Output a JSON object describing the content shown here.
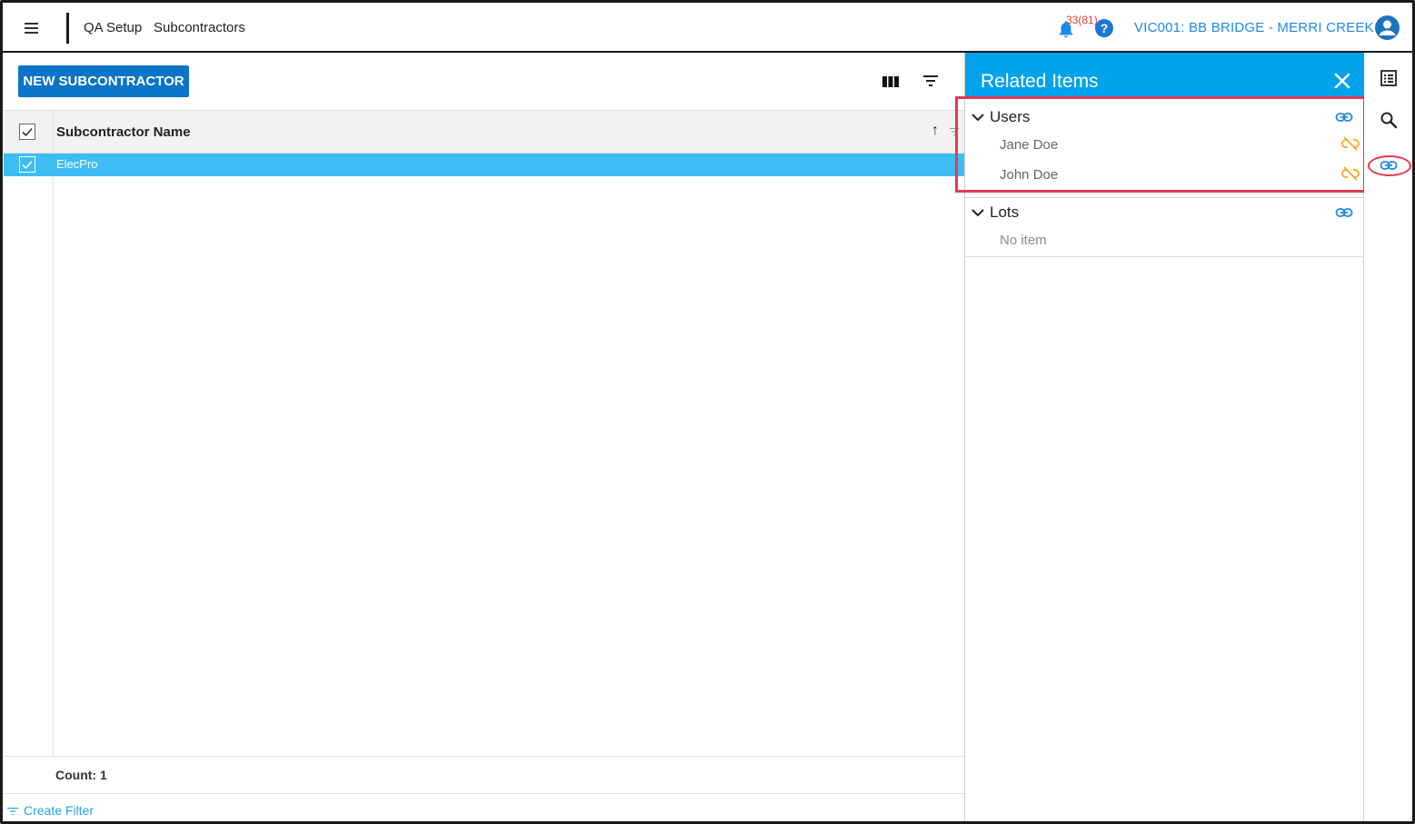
{
  "header": {
    "breadcrumb": [
      "QA Setup",
      "Subcontractors"
    ],
    "notification_count": "33(81)",
    "help_label": "?",
    "project": "VIC001: BB BRIDGE - MERRI CREEK"
  },
  "toolbar": {
    "new_button_label": "NEW SUBCONTRACTOR"
  },
  "grid": {
    "column_header": "Subcontractor Name",
    "sort_indicator": "↑",
    "rows": [
      {
        "name": "ElecPro",
        "selected": true
      }
    ],
    "count_label": "Count: 1",
    "create_filter_label": "Create Filter"
  },
  "related": {
    "title": "Related Items",
    "sections": [
      {
        "title": "Users",
        "items": [
          "Jane Doe",
          "John Doe"
        ]
      },
      {
        "title": "Lots",
        "empty_text": "No item"
      }
    ]
  },
  "colors": {
    "primary": "#0a74c9",
    "header_blue": "#03a2ec",
    "selected_row": "#3dbcf5",
    "link_blue": "#1e88e5",
    "unlink_orange": "#f5a623",
    "annotation_red": "#e53950"
  },
  "icons": {
    "menu": "hamburger-icon",
    "notifications": "bell-icon",
    "help": "help-circle-icon",
    "account": "account-circle-icon",
    "columns": "columns-icon",
    "filter": "filter-icon",
    "related_close": "close-icon",
    "link": "link-icon",
    "unlink": "unlink-icon",
    "rail_details": "list-details-icon",
    "rail_search": "search-icon",
    "rail_related": "link-icon"
  }
}
